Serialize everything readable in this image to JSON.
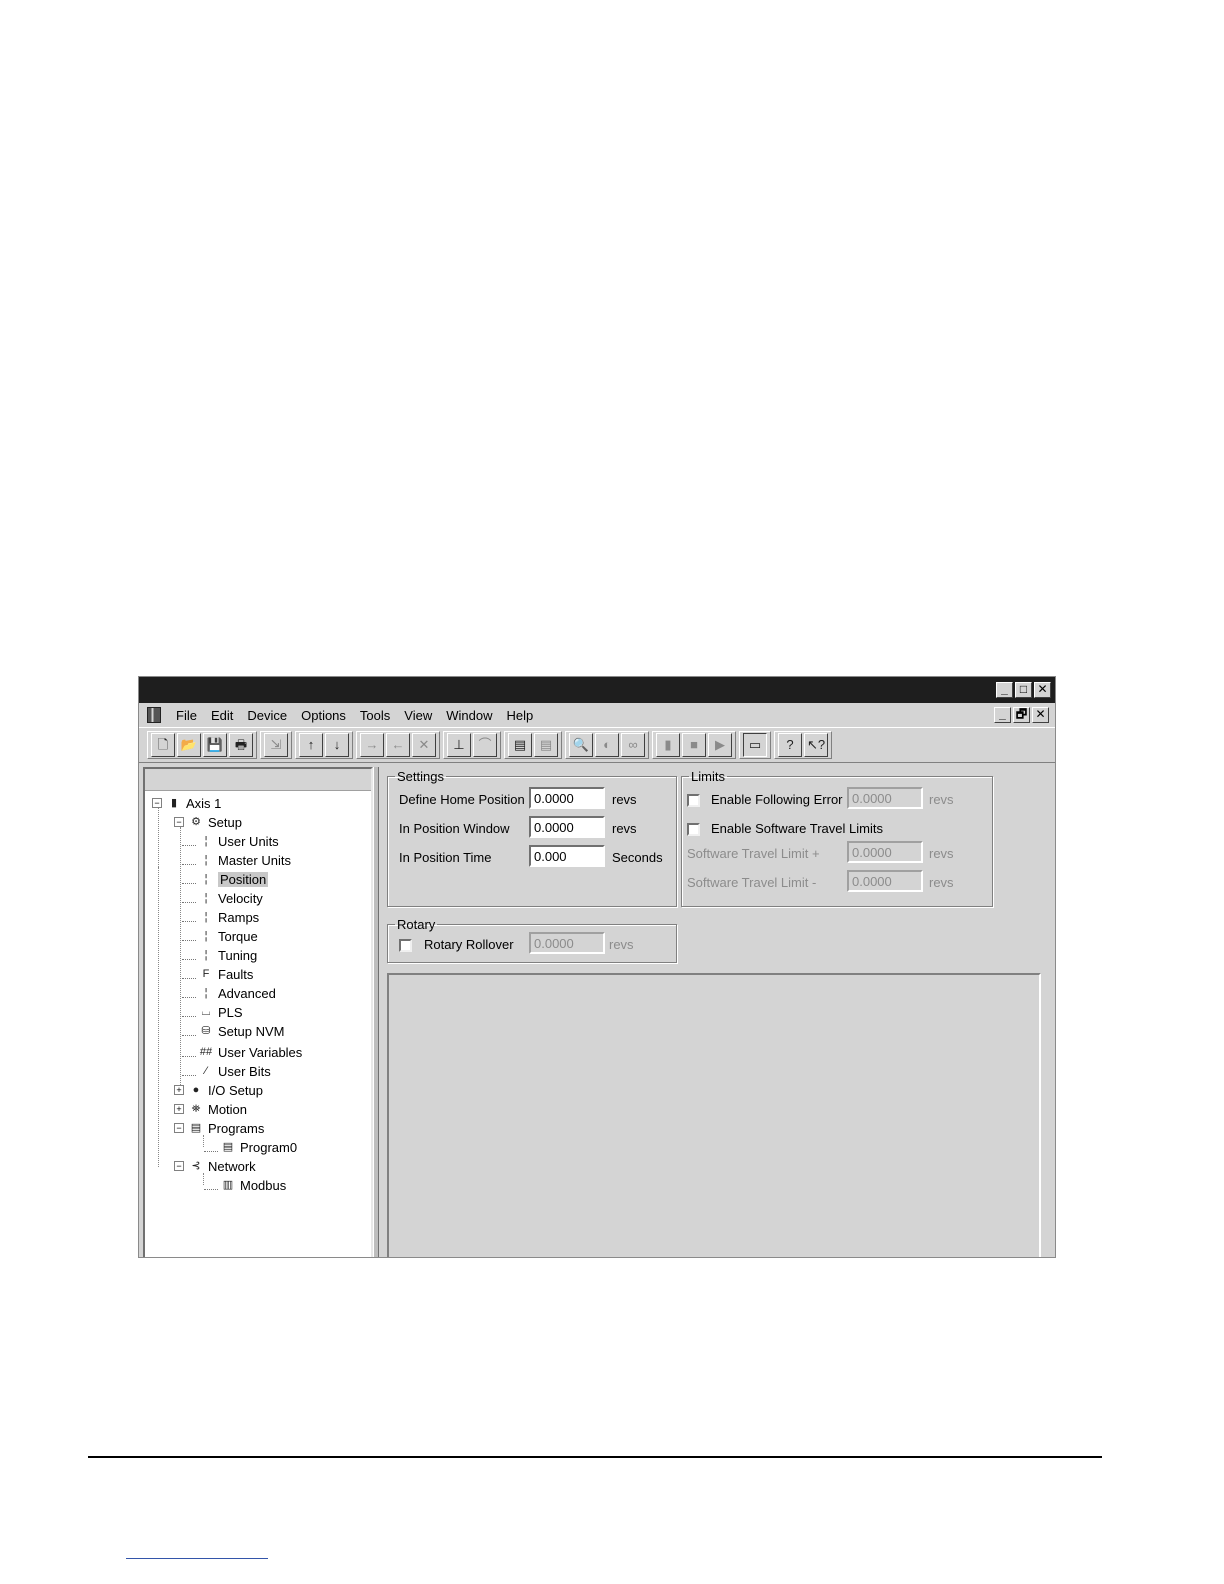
{
  "window": {
    "controls": {
      "minimize": "_",
      "maximize": "□",
      "close": "✕"
    },
    "mdi_controls": {
      "minimize": "_",
      "restore": "🗗",
      "close": "✕"
    }
  },
  "menubar": {
    "items": [
      "File",
      "Edit",
      "Device",
      "Options",
      "Tools",
      "View",
      "Window",
      "Help"
    ]
  },
  "toolbar": {
    "groups": [
      [
        {
          "name": "new-file-icon",
          "glyph": "🗋"
        },
        {
          "name": "open-folder-icon",
          "glyph": "📂"
        },
        {
          "name": "save-icon",
          "glyph": "💾"
        },
        {
          "name": "print-icon",
          "glyph": "🖶"
        }
      ],
      [
        {
          "name": "import-icon",
          "glyph": "⇲",
          "dim": true
        }
      ],
      [
        {
          "name": "upload-icon",
          "glyph": "↑"
        },
        {
          "name": "download-icon",
          "glyph": "↓"
        }
      ],
      [
        {
          "name": "connect-icon",
          "glyph": "→",
          "dim": true
        },
        {
          "name": "disconnect-icon",
          "glyph": "←",
          "dim": true
        },
        {
          "name": "cancel-icon",
          "glyph": "✕",
          "dim": true
        }
      ],
      [
        {
          "name": "enable-icon",
          "glyph": "⊥"
        },
        {
          "name": "disable-icon",
          "glyph": "⌒",
          "dim": true
        }
      ],
      [
        {
          "name": "program-icon",
          "glyph": "▤"
        },
        {
          "name": "program-list-icon",
          "glyph": "▤",
          "dim": true
        }
      ],
      [
        {
          "name": "zoom-icon",
          "glyph": "🔍",
          "dim": true
        },
        {
          "name": "watch-icon",
          "glyph": "◐",
          "dim": true
        },
        {
          "name": "binoculars-icon",
          "glyph": "∞",
          "dim": true
        }
      ],
      [
        {
          "name": "device-icon",
          "glyph": "▮",
          "dim": true
        },
        {
          "name": "stop-icon",
          "glyph": "■",
          "dim": true
        },
        {
          "name": "run-icon",
          "glyph": "▶",
          "dim": true
        }
      ],
      [
        {
          "name": "window-layout-icon",
          "glyph": "▭",
          "pressed": true
        }
      ],
      [
        {
          "name": "help-icon",
          "glyph": "?"
        },
        {
          "name": "context-help-icon",
          "glyph": "↖?"
        }
      ]
    ]
  },
  "tree": {
    "root": "Axis 1",
    "setup": {
      "label": "Setup",
      "children": [
        "User Units",
        "Master Units",
        "Position",
        "Velocity",
        "Ramps",
        "Torque",
        "Tuning",
        "Faults",
        "Advanced",
        "PLS",
        "Setup NVM",
        "User Variables",
        "User Bits"
      ],
      "selected": "Position"
    },
    "io_setup": "I/O Setup",
    "motion": "Motion",
    "programs": {
      "label": "Programs",
      "children": [
        "Program0"
      ]
    },
    "network": {
      "label": "Network",
      "children": [
        "Modbus"
      ]
    },
    "expand_minus": "−",
    "expand_plus": "+"
  },
  "settings": {
    "title": "Settings",
    "define_home_label": "Define Home Position",
    "define_home_value": "0.0000",
    "define_home_unit": "revs",
    "in_pos_window_label": "In Position Window",
    "in_pos_window_value": "0.0000",
    "in_pos_window_unit": "revs",
    "in_pos_time_label": "In Position Time",
    "in_pos_time_value": "0.000",
    "in_pos_time_unit": "Seconds"
  },
  "limits": {
    "title": "Limits",
    "following_error_label": "Enable Following Error",
    "following_error_value": "0.0000",
    "following_error_unit": "revs",
    "sw_travel_label": "Enable Software Travel Limits",
    "sw_limit_plus_label": "Software Travel Limit +",
    "sw_limit_plus_value": "0.0000",
    "sw_limit_plus_unit": "revs",
    "sw_limit_minus_label": "Software Travel Limit -",
    "sw_limit_minus_value": "0.0000",
    "sw_limit_minus_unit": "revs"
  },
  "rotary": {
    "title": "Rotary",
    "rollover_label": "Rotary Rollover",
    "rollover_value": "0.0000",
    "rollover_unit": "revs"
  }
}
